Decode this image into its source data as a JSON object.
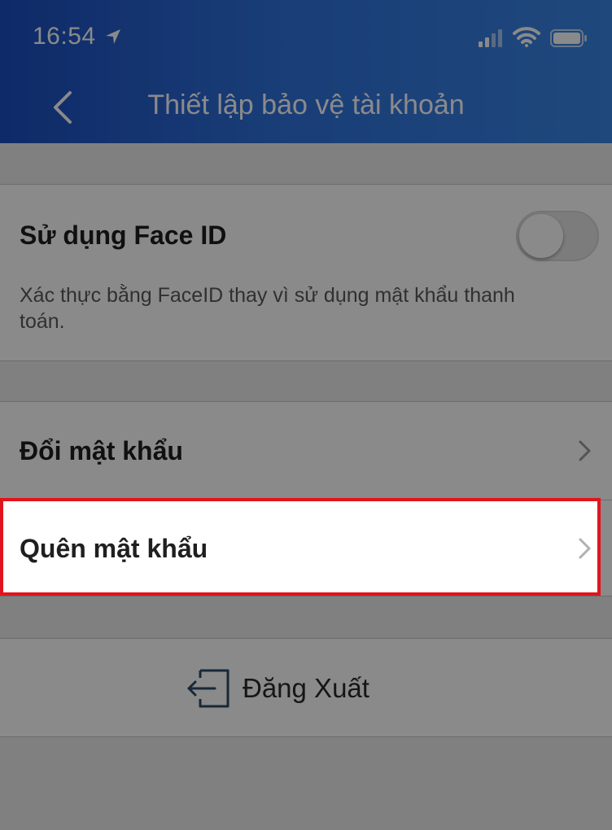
{
  "status_bar": {
    "time": "16:54"
  },
  "header": {
    "title": "Thiết lập bảo vệ tài khoản",
    "back_icon": "chevron-left-icon"
  },
  "face_id": {
    "title": "Sử dụng Face ID",
    "description": "Xác thực bằng FaceID thay vì sử dụng mật khẩu thanh toán.",
    "enabled": false
  },
  "password_rows": [
    {
      "label": "Đổi mật khẩu",
      "icon": "chevron-right-icon"
    },
    {
      "label": "Quên mật khẩu",
      "icon": "chevron-right-icon",
      "highlighted": true
    }
  ],
  "logout": {
    "label": "Đăng Xuất",
    "icon": "logout-icon"
  },
  "colors": {
    "header_start": "#1c4ec0",
    "header_end": "#3a86e6",
    "highlight_border": "#e0141c",
    "background": "#ececec"
  }
}
